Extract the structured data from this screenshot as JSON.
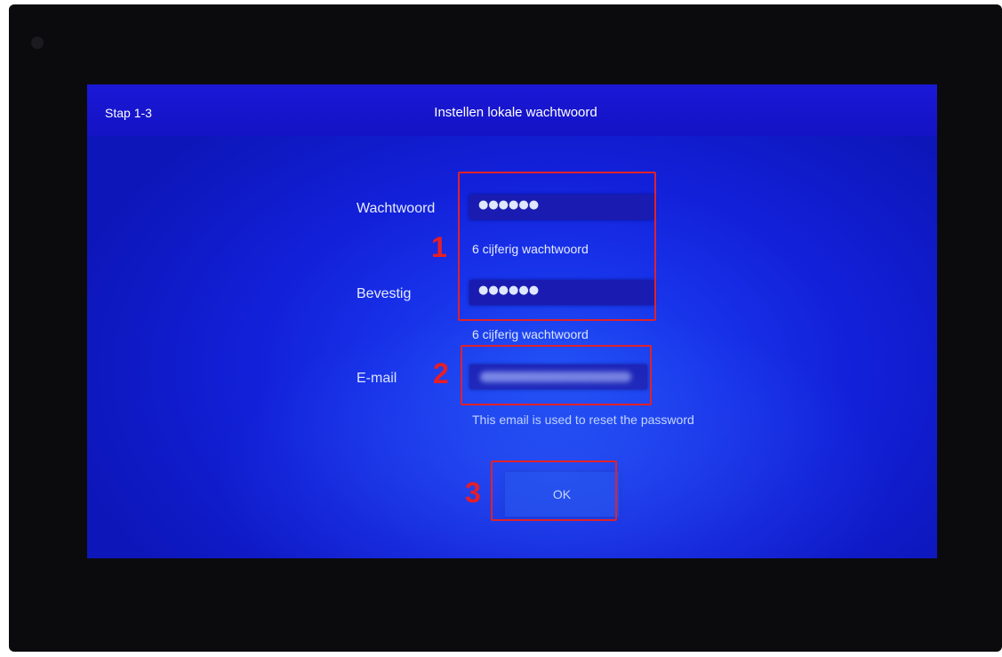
{
  "screen": {
    "step_label": "Stap 1-3",
    "title": "Instellen lokale wachtwoord"
  },
  "form": {
    "password": {
      "label": "Wachtwoord",
      "value_masked": "●●●●●●",
      "hint": "6 cijferig wachtwoord"
    },
    "confirm": {
      "label": "Bevestig",
      "value_masked": "●●●●●●",
      "hint": "6 cijferig wachtwoord"
    },
    "email": {
      "label": "E-mail",
      "hint": "This email is used to reset the password"
    },
    "ok_label": "OK"
  },
  "annotations": {
    "marker_1": "1",
    "marker_2": "2",
    "marker_3": "3",
    "color": "#e0222a"
  }
}
